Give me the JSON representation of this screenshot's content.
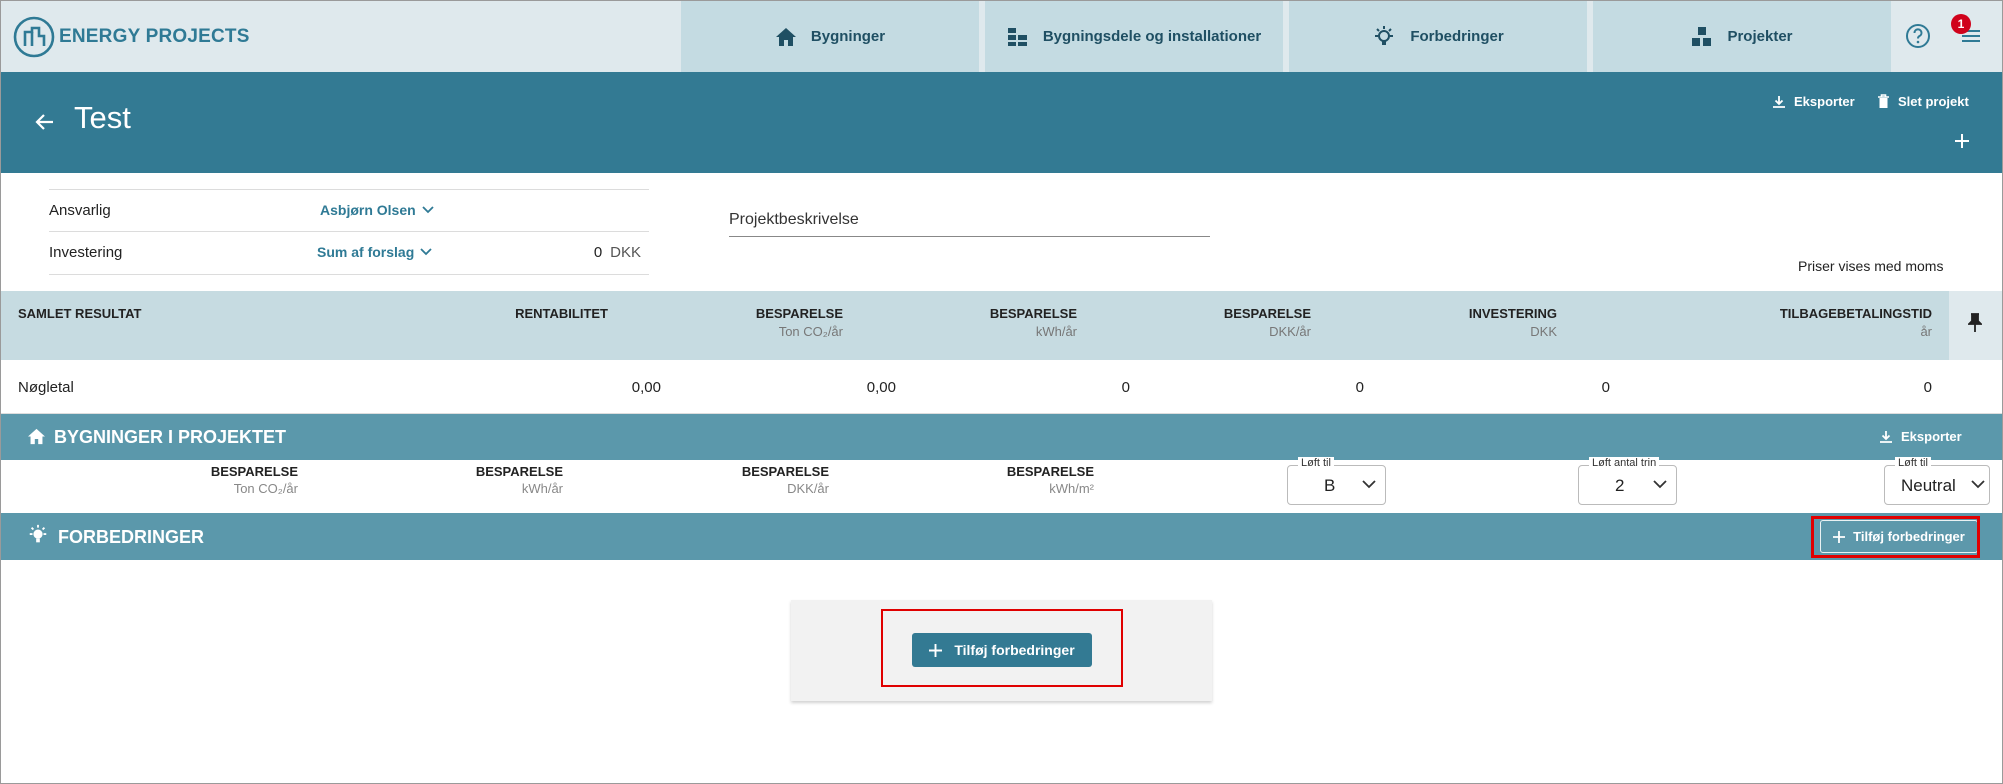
{
  "app": {
    "logo_text": "ENERGY PROJECTS",
    "notification_count": "1"
  },
  "nav": {
    "tabs": [
      {
        "label": "Bygninger",
        "icon": "home-icon"
      },
      {
        "label": "Bygningsdele og installationer",
        "icon": "building-parts-icon"
      },
      {
        "label": "Forbedringer",
        "icon": "lightbulb-icon"
      },
      {
        "label": "Projekter",
        "icon": "projects-icon"
      }
    ]
  },
  "header": {
    "title": "Test",
    "export_label": "Eksporter",
    "delete_label": "Slet projekt"
  },
  "info": {
    "responsible_label": "Ansvarlig",
    "responsible_value": "Asbjørn Olsen",
    "investment_label": "Investering",
    "investment_mode": "Sum af forslag",
    "investment_amount": "0",
    "investment_currency": "DKK",
    "description_placeholder": "Projektbeskrivelse",
    "prices_note": "Priser vises med moms"
  },
  "results": {
    "columns": [
      {
        "label": "SAMLET RESULTAT",
        "unit": ""
      },
      {
        "label": "RENTABILITET",
        "unit": ""
      },
      {
        "label": "BESPARELSE",
        "unit": "Ton CO₂/år"
      },
      {
        "label": "BESPARELSE",
        "unit": "kWh/år"
      },
      {
        "label": "BESPARELSE",
        "unit": "DKK/år"
      },
      {
        "label": "INVESTERING",
        "unit": "DKK"
      },
      {
        "label": "TILBAGEBETALINGSTID",
        "unit": "år"
      }
    ],
    "row": [
      "Nøgletal",
      "0,00",
      "0,00",
      "0",
      "0",
      "0",
      "0"
    ]
  },
  "buildings": {
    "title": "BYGNINGER I PROJEKTET",
    "export_label": "Eksporter",
    "columns": [
      {
        "label": "BESPARELSE",
        "unit": "Ton CO₂/år"
      },
      {
        "label": "BESPARELSE",
        "unit": "kWh/år"
      },
      {
        "label": "BESPARELSE",
        "unit": "DKK/år"
      },
      {
        "label": "BESPARELSE",
        "unit": "kWh/m²"
      }
    ],
    "selects": [
      {
        "legend": "Løft til",
        "value": "B"
      },
      {
        "legend": "Løft antal trin",
        "value": "2"
      },
      {
        "legend": "Løft til",
        "value": "Neutral"
      }
    ]
  },
  "improvements": {
    "title": "FORBEDRINGER",
    "add_label": "Tilføj forbedringer"
  },
  "colors": {
    "primary": "#337a93",
    "section": "#5b98ab",
    "nav_bg": "#dfe9ed",
    "nav_tab": "#c4dbe2",
    "highlight": "#e00000"
  }
}
